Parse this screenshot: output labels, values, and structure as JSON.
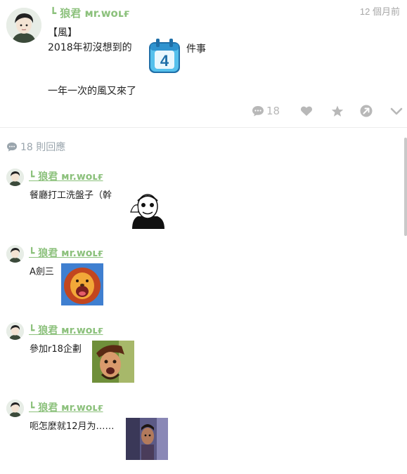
{
  "post": {
    "author": "┗ 狼君 ᴍr.woʟғ",
    "timestamp": "12 個月前",
    "line1": "【風】",
    "line2": "2018年初沒想到的",
    "calendar_number": "4",
    "line2_after": "件事",
    "line3": "一年一次的風又來了",
    "actions": {
      "comment_count": "18",
      "icons": [
        "comment-icon",
        "heart-icon",
        "star-icon",
        "share-icon",
        "chevron-down-icon"
      ]
    }
  },
  "replies_header": {
    "label": "18 則回應",
    "icon": "comment-icon"
  },
  "replies": [
    {
      "author": "┗ 狼君 ᴍr.woʟғ",
      "text": "餐廳打工洗盤子（幹",
      "sticker": "rage-face-sticker"
    },
    {
      "author": "┗ 狼君 ᴍr.woʟғ",
      "text": "A劍三",
      "sticker": "lion-sticker"
    },
    {
      "author": "┗ 狼君 ᴍr.woʟғ",
      "text": "參加r18企劃",
      "sticker": "pirate-sticker"
    },
    {
      "author": "┗ 狼君 ᴍr.woʟғ",
      "text": "呃怎麼就12月为……",
      "sticker": "peeking-man-sticker"
    }
  ],
  "colors": {
    "author_green": "#8cc17c",
    "muted_gray": "#b8b8b8",
    "calendar_blue": "#3aa6d8"
  }
}
